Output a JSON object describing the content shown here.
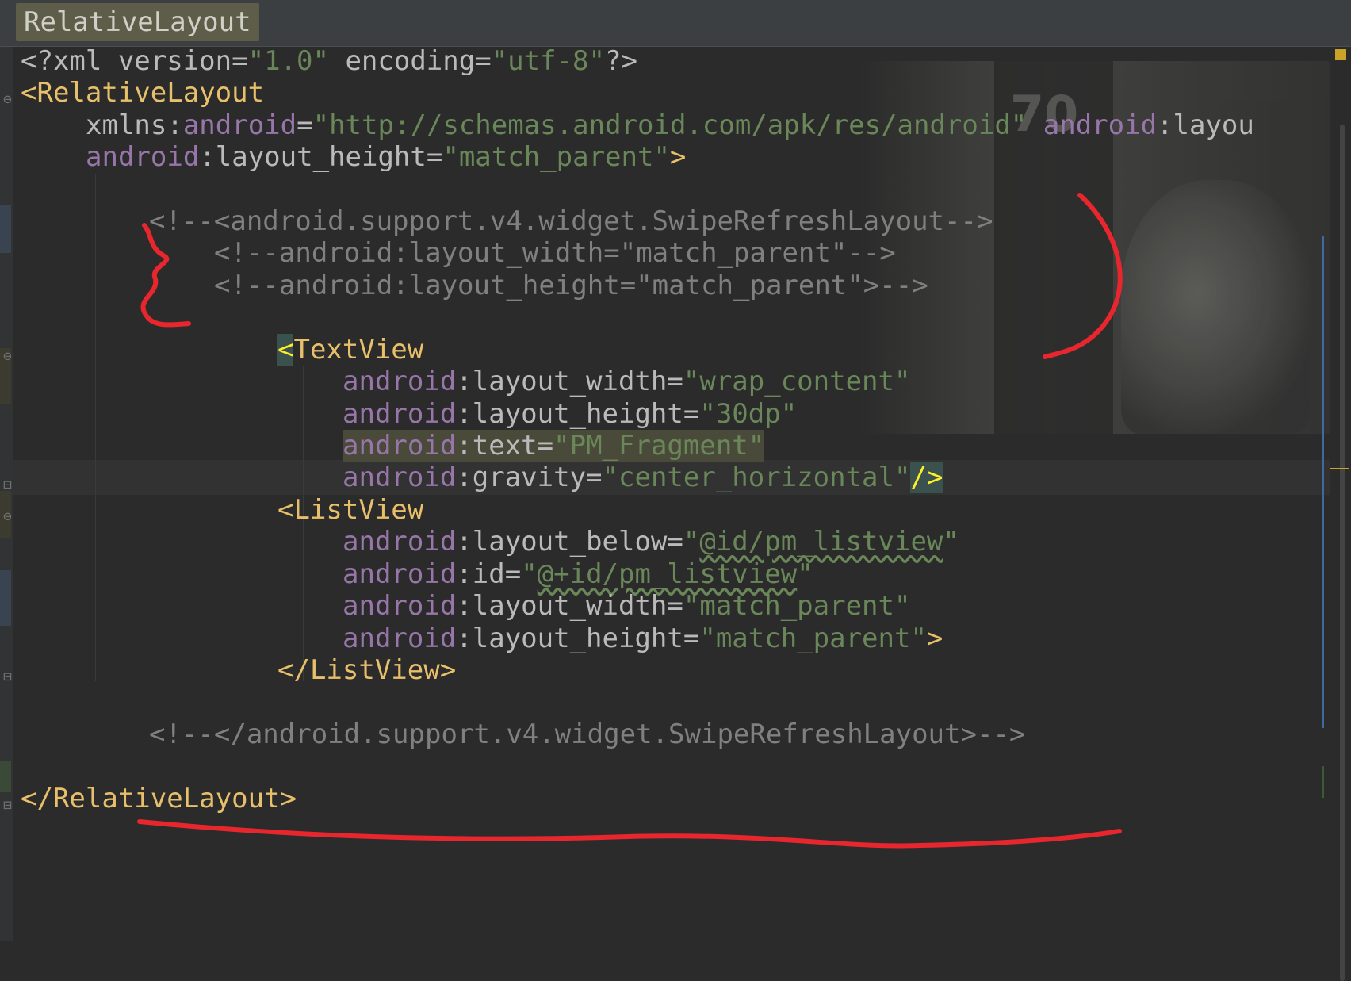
{
  "breadcrumb": {
    "label": "RelativeLayout"
  },
  "colors": {
    "background": "#2b2b2b",
    "tag": "#e8bf6a",
    "attribute": "#bababa",
    "namespace": "#9876aa",
    "string": "#6a8759",
    "comment": "#808080",
    "annotation": "#e8262e"
  },
  "code": {
    "l1": {
      "pi_open": "<?xml ",
      "a1": "version",
      "eq1": "=",
      "v1": "\"1.0\"",
      "a2": " encoding",
      "eq2": "=",
      "v2": "\"utf-8\"",
      "pi_close": "?>"
    },
    "l2": {
      "tag": "<RelativeLayout"
    },
    "l3": {
      "a": "xmlns:",
      "ns1": "android",
      "eq": "=",
      "v": "\"http://schemas.android.com/apk/res/android\"",
      "ns2": " android",
      "rest": ":layou"
    },
    "l4": {
      "ns": "android",
      "a": ":layout_height=",
      "v": "\"match_parent\"",
      "close": ">"
    },
    "l5": {
      "c": "<!--<android.support.v4.widget.SwipeRefreshLayout-->"
    },
    "l6": {
      "c": "<!--android:layout_width=\"match_parent\"-->"
    },
    "l7": {
      "c": "<!--android:layout_height=\"match_parent\">-->"
    },
    "l8": {
      "lt": "<",
      "tag": "TextView"
    },
    "l9": {
      "ns": "android",
      "a": ":layout_width=",
      "v": "\"wrap_content\""
    },
    "l10": {
      "ns": "android",
      "a": ":layout_height=",
      "v": "\"30dp\""
    },
    "l11": {
      "ns": "android",
      "a": ":text=",
      "v": "\"PM_Fragment\""
    },
    "l12": {
      "ns": "android",
      "a": ":gravity=",
      "v": "\"center_horizontal\"",
      "close": "/>"
    },
    "l13": {
      "tag": "<ListView"
    },
    "l14": {
      "ns": "android",
      "a": ":layout_below=",
      "q1": "\"",
      "v": "@id/pm_listview",
      "q2": "\""
    },
    "l15": {
      "ns": "android",
      "a": ":id=",
      "q1": "\"",
      "v": "@+id/pm_listview",
      "q2": "\""
    },
    "l16": {
      "ns": "android",
      "a": ":layout_width=",
      "v": "\"match_parent\""
    },
    "l17": {
      "ns": "android",
      "a": ":layout_height=",
      "v": "\"match_parent\"",
      "close": ">"
    },
    "l18": {
      "tag": "</ListView>"
    },
    "l19": {
      "c": "<!--</android.support.v4.widget.SwipeRefreshLayout>-->"
    },
    "l20": {
      "tag": "</RelativeLayout>"
    }
  }
}
